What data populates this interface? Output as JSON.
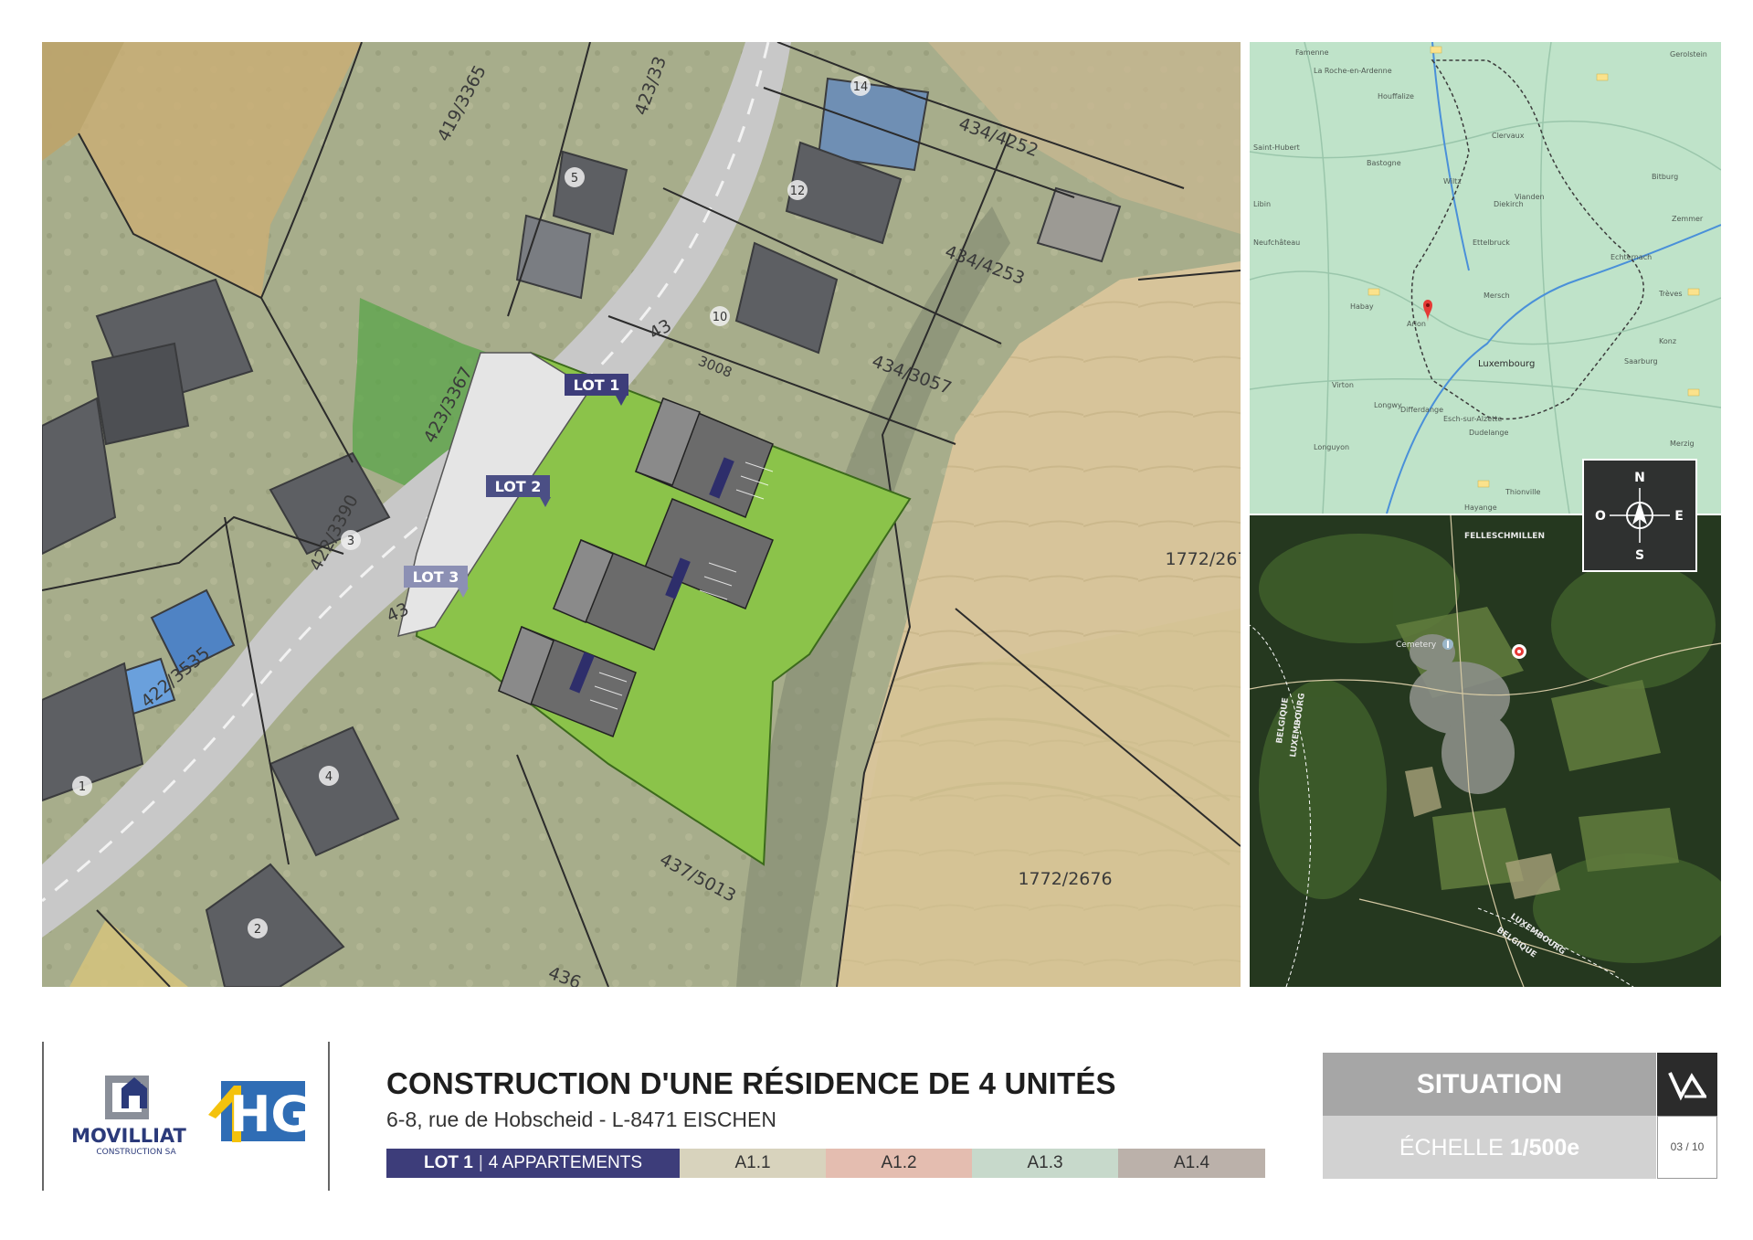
{
  "main_map": {
    "lot_labels": [
      "LOT 1",
      "LOT 2",
      "LOT 3"
    ],
    "parcel_labels": [
      "419/3365",
      "423/33",
      "434/4252",
      "434/4253",
      "434/3057",
      "43",
      "3008",
      "423/3367",
      "422/3390",
      "422/3535",
      "1772/267",
      "1772/2676",
      "437/5013",
      "436",
      "43"
    ],
    "house_numbers": [
      "14",
      "5",
      "12",
      "10",
      "3",
      "4",
      "1",
      "2"
    ]
  },
  "regional_map": {
    "place_labels": [
      "Famenne",
      "La Roche-en-Ardenne",
      "Houffalize",
      "Saint-Hubert",
      "Bastogne",
      "Wiltz",
      "Clervaux",
      "Vianden",
      "Bitburg",
      "Diekirch",
      "Ettelbruck",
      "Echternach",
      "Libin",
      "Neufchâteau",
      "Habay",
      "Arlon",
      "Mersch",
      "Luxembourg",
      "Virton",
      "Longwy",
      "Esch-sur-Alzette",
      "Dudelange",
      "Differdange",
      "Longuyon",
      "Thionville",
      "Hayange",
      "Trèves",
      "Konz",
      "Saarburg",
      "Merzig",
      "Zemmer",
      "Gerolstein"
    ]
  },
  "satellite_map": {
    "labels": [
      "FELLESCHMILLEN",
      "Cemetery",
      "BELGIQUE",
      "LUXEMBOURG",
      "LUXEMBOURG",
      "BELGIQUE"
    ]
  },
  "compass": {
    "n": "N",
    "s": "S",
    "e": "E",
    "w": "O"
  },
  "logos": {
    "movilliat_name": "MOVILLIAT",
    "movilliat_sub": "CONSTRUCTION SA",
    "hg": "HG"
  },
  "title_block": {
    "title": "CONSTRUCTION D'UNE RÉSIDENCE DE 4 UNITÉS",
    "address": "6-8, rue de Hobscheid - L-8471 EISCHEN",
    "lot_label": "LOT 1",
    "lot_detail": "4 APPARTEMENTS",
    "units": [
      {
        "label": "A1.1",
        "color": "#d8d3bd"
      },
      {
        "label": "A1.2",
        "color": "#e4bdb0"
      },
      {
        "label": "A1.3",
        "color": "#c7d9cb"
      },
      {
        "label": "A1.4",
        "color": "#bbb1aa"
      }
    ]
  },
  "sheet": {
    "name": "SITUATION",
    "scale_prefix": "ÉCHELLE",
    "scale_value": "1/500e",
    "page": "03 / 10"
  },
  "colors": {
    "accent_navy": "#3d3d7a",
    "lot_label_bg": "#4b4f85",
    "site_green": "#8bc34a",
    "parcel_green": "#5aa64a",
    "sheet_grey_dark": "#a6a6a6",
    "sheet_grey_light": "#d2d2d2"
  }
}
